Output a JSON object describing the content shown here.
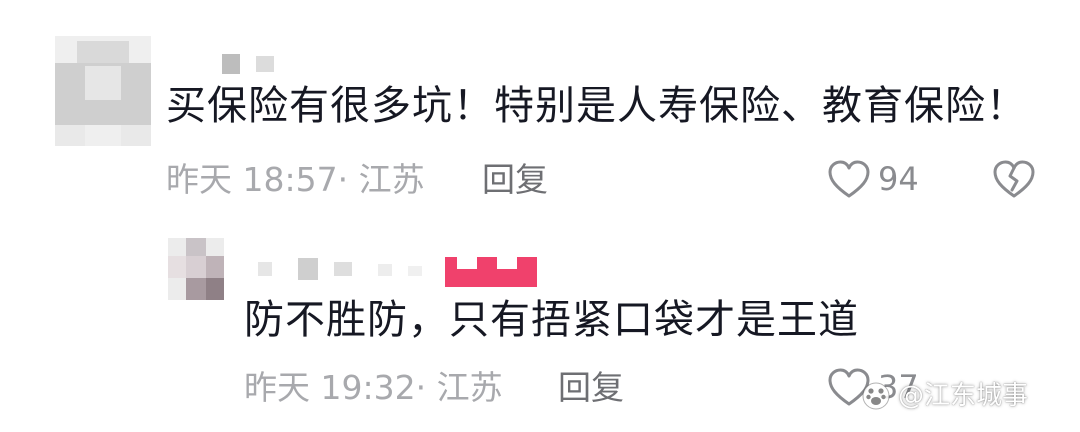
{
  "comments": [
    {
      "text": "买保险有很多坑！特别是人寿保险、教育保险！",
      "meta": "昨天 18:57· 江苏",
      "reply_label": "回复",
      "likes": "94",
      "like_icon": "heart-outline-icon",
      "dislike_icon": "broken-heart-icon"
    },
    {
      "text": "防不胜防，只有捂紧口袋才是王道",
      "meta": "昨天 19:32· 江苏",
      "reply_label": "回复",
      "likes": "37",
      "like_icon": "heart-outline-icon"
    }
  ],
  "watermark": {
    "text": "@江东城事",
    "icon": "paw-logo-icon"
  },
  "colors": {
    "text": "#161823",
    "meta": "#a8a9ad",
    "reply": "#6e6f73",
    "badge": "#f0416c"
  }
}
